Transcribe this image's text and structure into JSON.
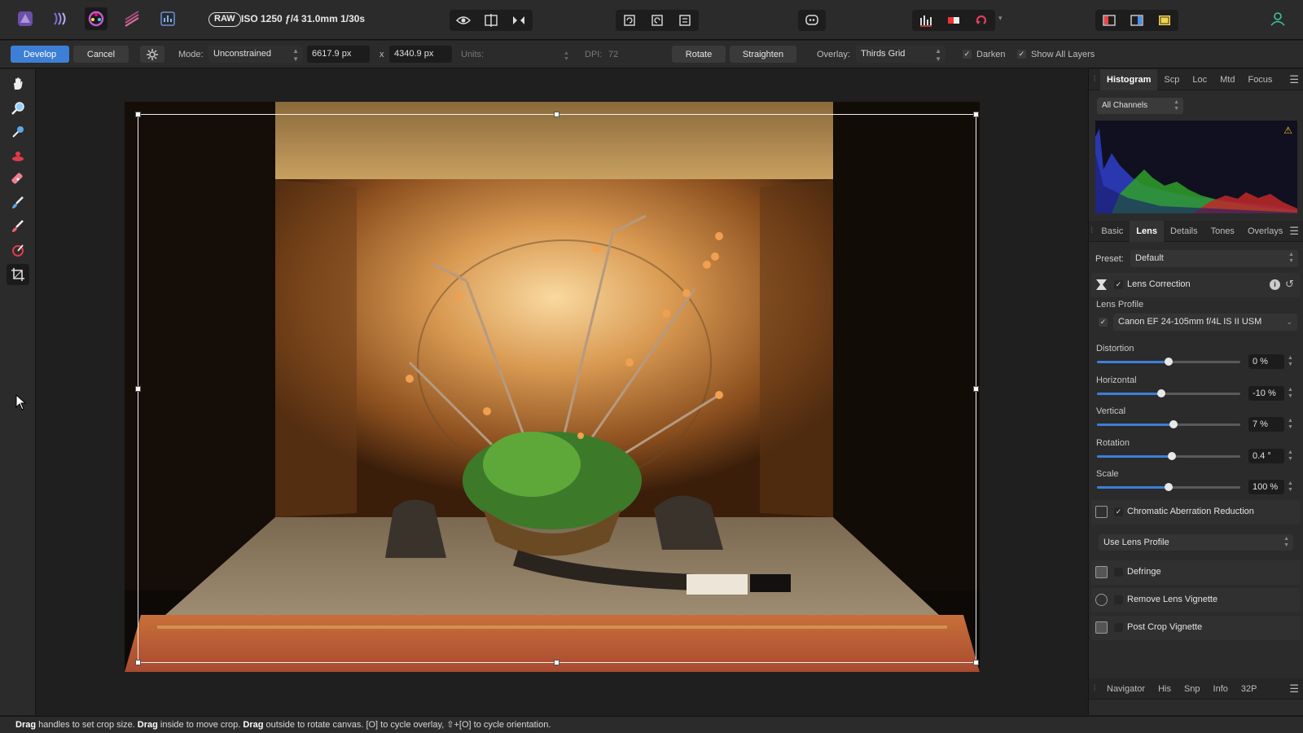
{
  "topbar": {
    "raw_badge": "RAW",
    "exif": "ISO 1250 ƒ/4 31.0mm 1/30s"
  },
  "context": {
    "develop_label": "Develop",
    "cancel_label": "Cancel",
    "mode_label": "Mode:",
    "mode_value": "Unconstrained",
    "width_value": "6617.9 px",
    "x_sep": "x",
    "height_value": "4340.9 px",
    "units_label": "Units:",
    "dpi_label": "DPI:",
    "dpi_value": "72",
    "rotate_label": "Rotate",
    "straighten_label": "Straighten",
    "overlay_label": "Overlay:",
    "overlay_value": "Thirds Grid",
    "darken_label": "Darken",
    "darken_checked": true,
    "show_all_layers_label": "Show All Layers",
    "show_all_layers_checked": true
  },
  "panel_top": {
    "tabs": [
      "Histogram",
      "Scp",
      "Loc",
      "Mtd",
      "Focus"
    ],
    "active_tab": "Histogram",
    "channel": "All Channels"
  },
  "panel_mid": {
    "tabs": [
      "Basic",
      "Lens",
      "Details",
      "Tones",
      "Overlays"
    ],
    "active_tab": "Lens",
    "preset_label": "Preset:",
    "preset_value": "Default",
    "lens_correction_label": "Lens Correction",
    "lens_correction_checked": true,
    "lens_profile_label": "Lens Profile",
    "lens_profile_value": "Canon EF 24-105mm f/4L IS II USM",
    "lens_profile_checked": true,
    "sliders": [
      {
        "label": "Distortion",
        "value": "0 %",
        "pos": 0.5
      },
      {
        "label": "Horizontal",
        "value": "-10 %",
        "pos": 0.45
      },
      {
        "label": "Vertical",
        "value": "7 %",
        "pos": 0.535
      },
      {
        "label": "Rotation",
        "value": "0.4 °",
        "pos": 0.52
      },
      {
        "label": "Scale",
        "value": "100 %",
        "pos": 0.5
      }
    ],
    "chromatic_label": "Chromatic Aberration Reduction",
    "chromatic_checked": true,
    "chromatic_mode": "Use Lens Profile",
    "defringe_label": "Defringe",
    "vignette_label": "Remove Lens Vignette",
    "postcrop_label": "Post Crop Vignette"
  },
  "panel_bottom": {
    "tabs": [
      "Navigator",
      "His",
      "Snp",
      "Info",
      "32P"
    ],
    "active_tab": "Navigator"
  },
  "status": {
    "w1": "Drag",
    "t1": " handles to set crop size. ",
    "w2": "Drag",
    "t2": " inside to move crop. ",
    "w3": "Drag",
    "t3": " outside to rotate canvas. [O] to cycle overlay, ⇧+[O] to cycle orientation."
  }
}
